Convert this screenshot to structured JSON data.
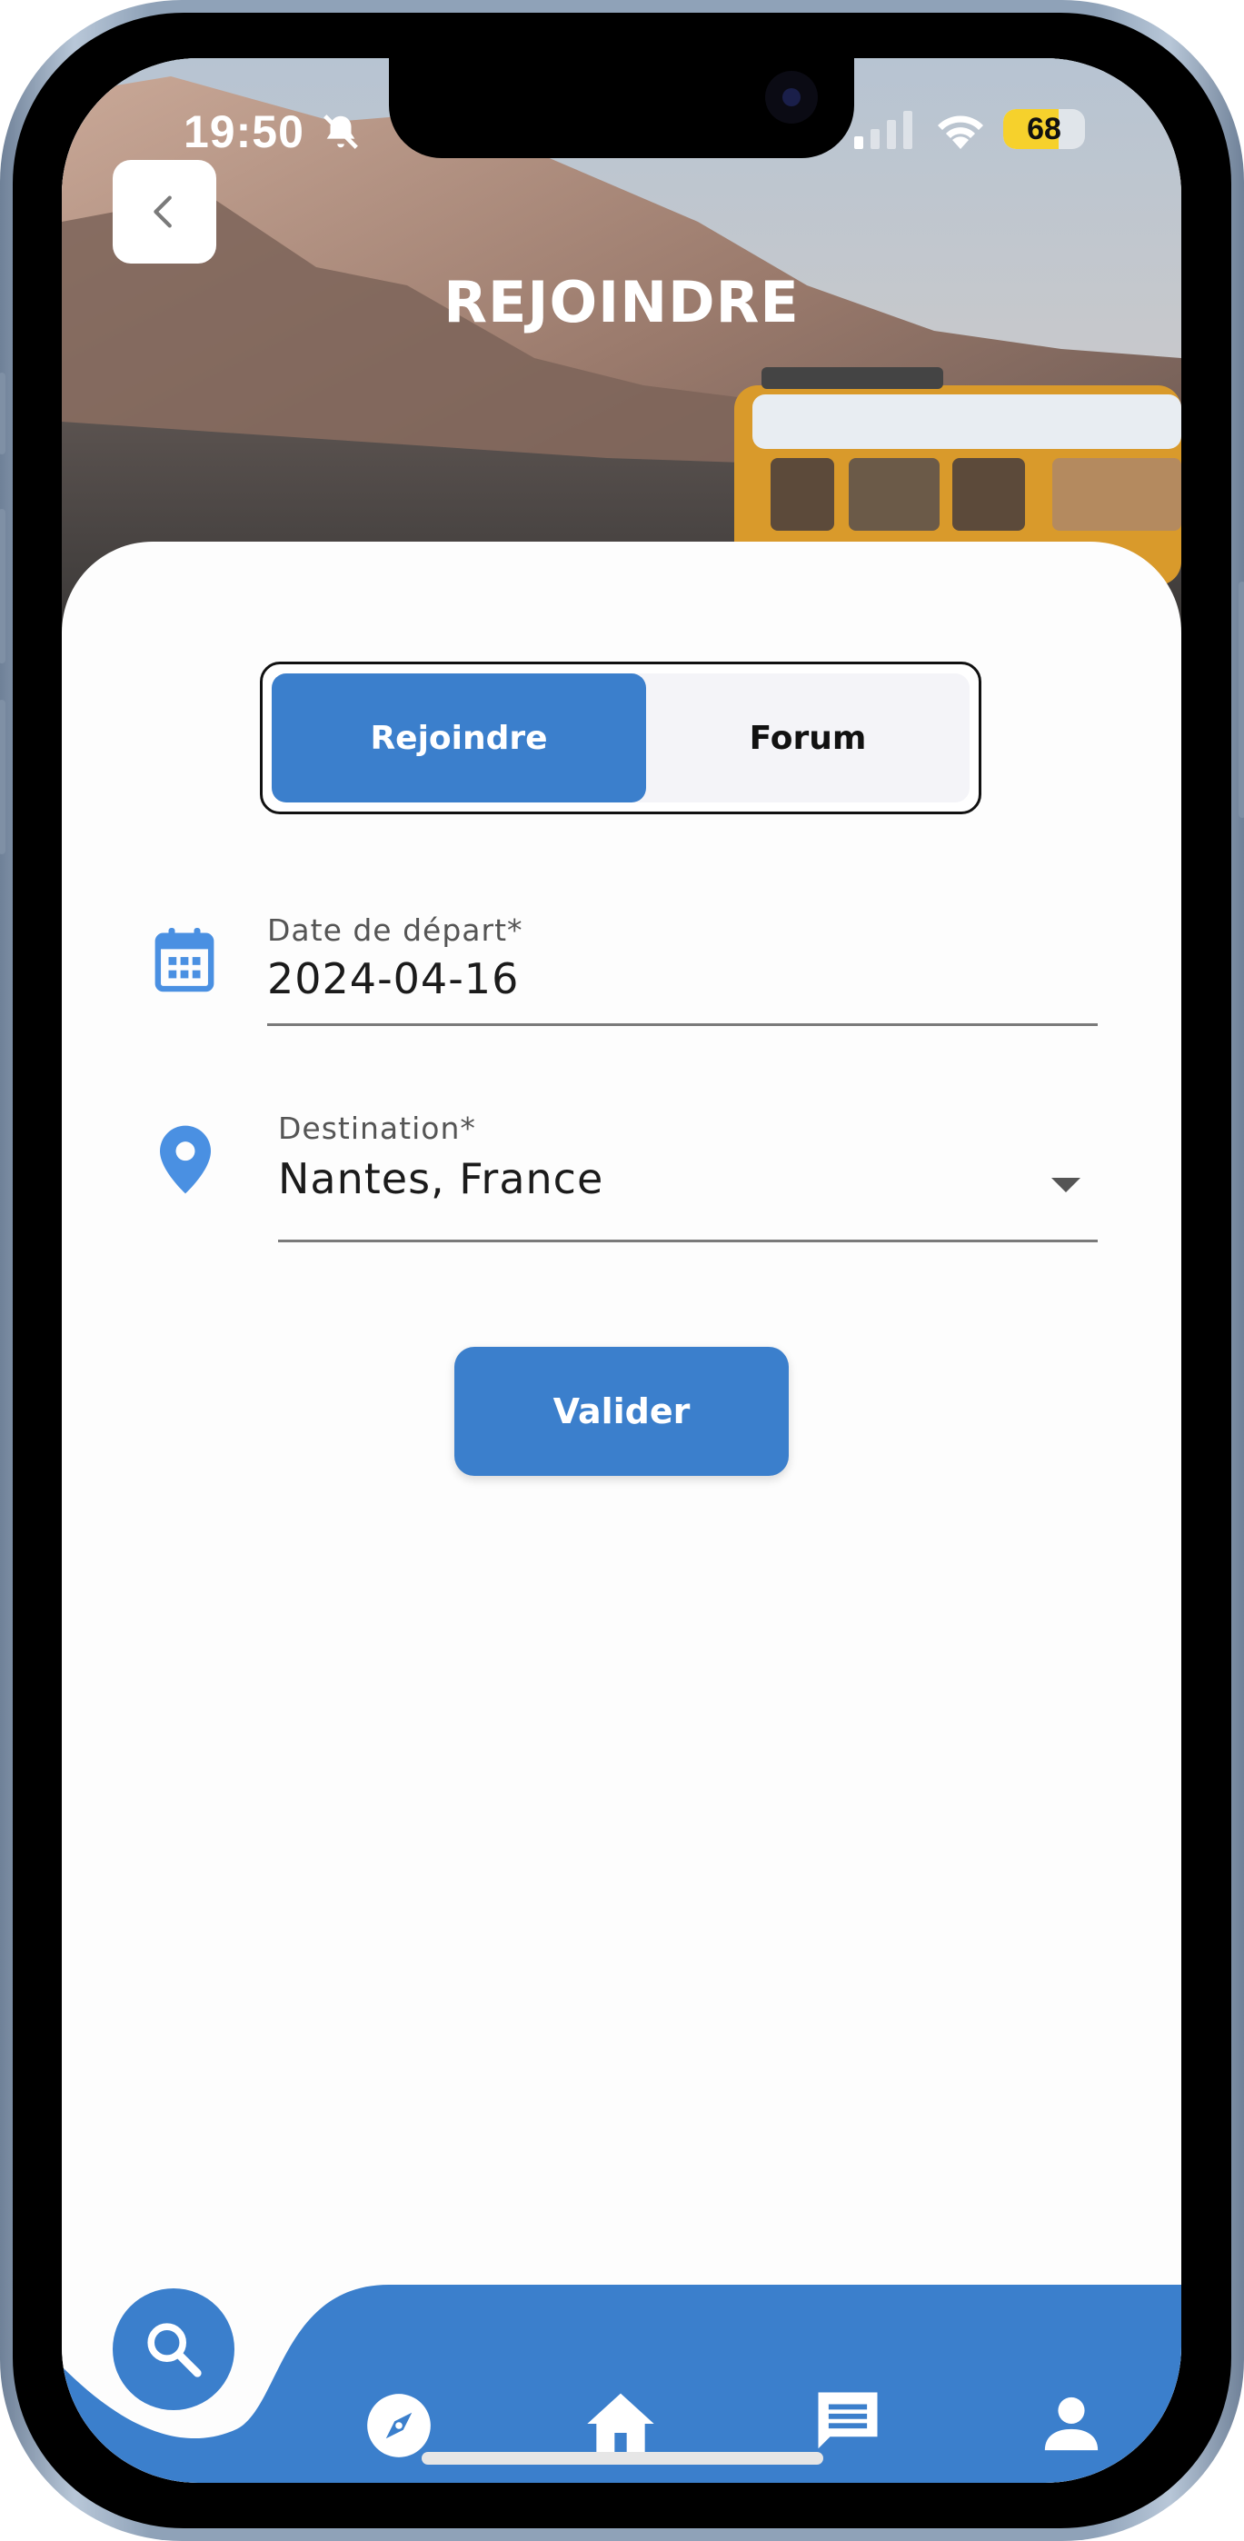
{
  "status_bar": {
    "time": "19:50",
    "battery_level": "68",
    "battery_fraction": 0.68
  },
  "header": {
    "title": "REJOINDRE",
    "back_icon": "chevron-left-icon"
  },
  "toggle": {
    "tabs": [
      {
        "label": "Rejoindre",
        "active": true
      },
      {
        "label": "Forum",
        "active": false
      }
    ]
  },
  "form": {
    "date_field": {
      "icon": "calendar-icon",
      "label": "Date de départ*",
      "value": "2024-04-16"
    },
    "destination_field": {
      "icon": "location-pin-icon",
      "label": "Destination*",
      "value": "Nantes, France",
      "dropdown_icon": "caret-down-icon"
    },
    "submit_label": "Valider"
  },
  "bottom_nav": {
    "items": [
      {
        "name": "search",
        "icon": "search-icon"
      },
      {
        "name": "explore",
        "icon": "compass-icon"
      },
      {
        "name": "home",
        "icon": "home-icon"
      },
      {
        "name": "messages",
        "icon": "chat-icon"
      },
      {
        "name": "profile",
        "icon": "person-icon"
      }
    ]
  },
  "colors": {
    "accent": "#3b7fcc",
    "field_icon": "#4a90e2",
    "text": "#1b1b1b",
    "battery": "#f6d12c"
  }
}
